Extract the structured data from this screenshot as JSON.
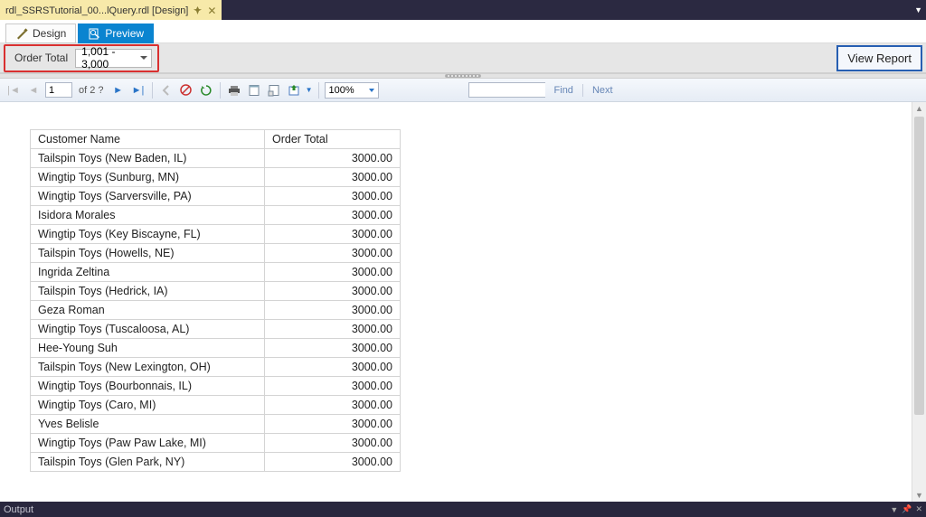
{
  "titlebar": {
    "doc_tab_label": "rdl_SSRSTutorial_00...lQuery.rdl [Design]"
  },
  "viewtabs": {
    "design": "Design",
    "preview": "Preview"
  },
  "params": {
    "label": "Order Total",
    "value": "1,001 - 3,000",
    "view_report": "View Report"
  },
  "rv": {
    "page": "1",
    "of": "of  2 ?",
    "zoom": "100%",
    "find": "Find",
    "next": "Next"
  },
  "table": {
    "headers": {
      "name": "Customer Name",
      "total": "Order Total"
    },
    "rows": [
      {
        "name": "Tailspin Toys (New Baden, IL)",
        "total": "3000.00"
      },
      {
        "name": "Wingtip Toys (Sunburg, MN)",
        "total": "3000.00"
      },
      {
        "name": "Wingtip Toys (Sarversville, PA)",
        "total": "3000.00"
      },
      {
        "name": "Isidora Morales",
        "total": "3000.00"
      },
      {
        "name": "Wingtip Toys (Key Biscayne, FL)",
        "total": "3000.00"
      },
      {
        "name": "Tailspin Toys (Howells, NE)",
        "total": "3000.00"
      },
      {
        "name": "Ingrida Zeltina",
        "total": "3000.00"
      },
      {
        "name": "Tailspin Toys (Hedrick, IA)",
        "total": "3000.00"
      },
      {
        "name": "Geza Roman",
        "total": "3000.00"
      },
      {
        "name": "Wingtip Toys (Tuscaloosa, AL)",
        "total": "3000.00"
      },
      {
        "name": "Hee-Young Suh",
        "total": "3000.00"
      },
      {
        "name": "Tailspin Toys (New Lexington, OH)",
        "total": "3000.00"
      },
      {
        "name": "Wingtip Toys (Bourbonnais, IL)",
        "total": "3000.00"
      },
      {
        "name": "Wingtip Toys (Caro, MI)",
        "total": "3000.00"
      },
      {
        "name": "Yves Belisle",
        "total": "3000.00"
      },
      {
        "name": "Wingtip Toys (Paw Paw Lake, MI)",
        "total": "3000.00"
      },
      {
        "name": "Tailspin Toys (Glen Park, NY)",
        "total": "3000.00"
      }
    ]
  },
  "output": {
    "label": "Output"
  }
}
